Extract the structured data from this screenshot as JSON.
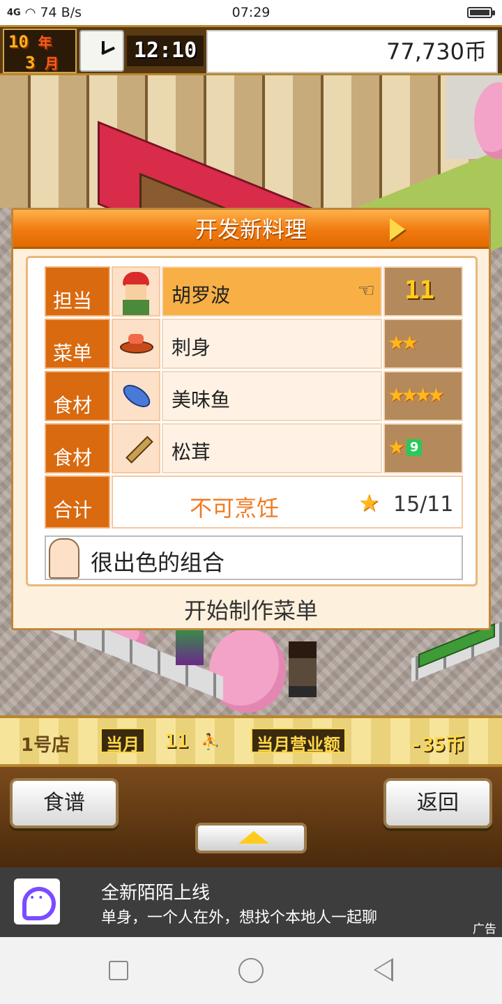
{
  "status_bar": {
    "signal": "4G",
    "speed": "74 B/s",
    "time": "07:29"
  },
  "top_bar": {
    "year_num": "10",
    "year_unit": "年",
    "month_num": "3",
    "month_unit": "月",
    "clock_time": "12:10",
    "money": "77,730币"
  },
  "dialog": {
    "title": "开发新料理",
    "rows": [
      {
        "label": "担当",
        "name": "胡罗波",
        "icon": "chef-icon",
        "value": "11",
        "selected": true
      },
      {
        "label": "菜单",
        "name": "刺身",
        "icon": "dish-icon",
        "stars": 2
      },
      {
        "label": "食材",
        "name": "美味鱼",
        "icon": "fish-icon",
        "stars": 4
      },
      {
        "label": "食材",
        "name": "松茸",
        "icon": "mushroom-icon",
        "stars": 1,
        "star_level": "9"
      }
    ],
    "total": {
      "label": "合计",
      "status": "不可烹饪",
      "score": "15/11"
    },
    "comment": "很出色的组合",
    "start_button": "开始制作菜单"
  },
  "info_bar": {
    "store": "1号店",
    "month_label": "当月",
    "visitors": "11",
    "sales_label": "当月营业额",
    "sales_value": "-35币"
  },
  "controls": {
    "recipe_button": "食谱",
    "back_button": "返回"
  },
  "ad": {
    "title": "全新陌陌上线",
    "subtitle": "单身，一个人在外，想找个本地人一起聊",
    "tag": "广告"
  },
  "colors": {
    "dialog_header": "#f07a10",
    "label_bg": "#d96a10",
    "status_text": "#f07a20",
    "star": "#ffb81c"
  }
}
